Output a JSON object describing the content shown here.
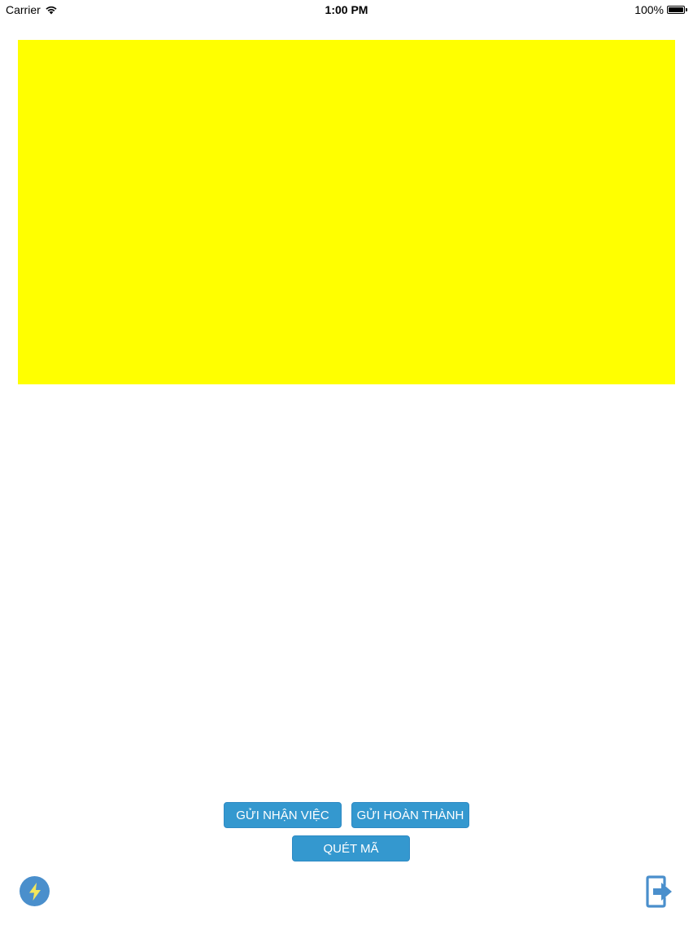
{
  "status_bar": {
    "carrier": "Carrier",
    "time": "1:00 PM",
    "battery": "100%"
  },
  "preview": {
    "color": "#ffff00"
  },
  "actions": {
    "receive_label": "GỬI NHẬN VIỆC",
    "complete_label": "GỬI HOÀN THÀNH",
    "scan_label": "QUÉT MÃ"
  },
  "theme": {
    "button_color": "#3498cf",
    "flash_bg": "#4a8fcc",
    "flash_bolt": "#f2e65c",
    "logout_color": "#4a8fcc"
  },
  "icons": {
    "flash": "lightning-bolt-icon",
    "logout": "exit-arrow-icon",
    "wifi": "wifi-icon",
    "battery": "battery-icon"
  }
}
